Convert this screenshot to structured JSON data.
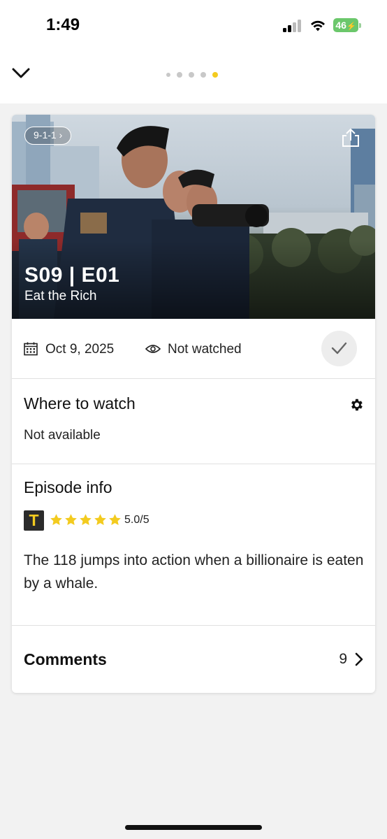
{
  "status_bar": {
    "time": "1:49",
    "battery_level": "46",
    "icons": [
      "cellular-signal-icon",
      "wifi-icon",
      "battery-charging-icon"
    ]
  },
  "nav": {
    "back_icon": "chevron-down-icon",
    "page_count": 5,
    "active_page_index": 4
  },
  "episode": {
    "show_chip": "9-1-1 ›",
    "code": "S09 | E01",
    "title": "Eat the Rich",
    "air_date": "Oct 9, 2025",
    "watch_status": "Not watched"
  },
  "where_to_watch": {
    "heading": "Where to watch",
    "availability": "Not available"
  },
  "episode_info": {
    "heading": "Episode info",
    "rating_source_logo": "T",
    "stars": 5,
    "rating": "5.0/5",
    "synopsis": "The 118 jumps into action when a billionaire is eaten by a whale."
  },
  "comments": {
    "heading": "Comments",
    "count": "9"
  },
  "colors": {
    "accent_yellow": "#f3cb1f",
    "battery_green": "#6bc76b",
    "page_background": "#f2f2f2"
  }
}
